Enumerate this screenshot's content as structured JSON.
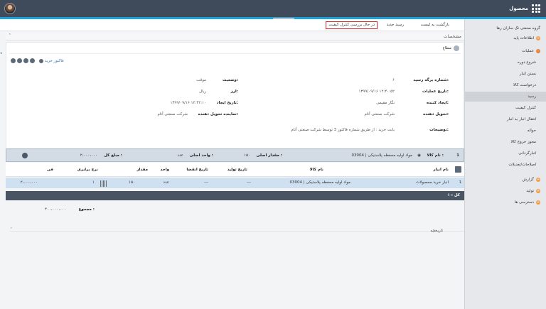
{
  "app": {
    "title": "محصول"
  },
  "toolbar": {
    "back": "بازگشت به لیست",
    "new_receipt": "رسید جدید",
    "status": "در حال بررسی کنترل کیفیت"
  },
  "section": {
    "title": "مشخصات"
  },
  "user": {
    "name": "مطاع"
  },
  "actions": {
    "invoice_link": "فاکتور خرید"
  },
  "form": {
    "receipt_no_label": "شماره برگه رسید:",
    "receipt_no": "۶",
    "status_label": "وضعیت:",
    "status": "موقت",
    "op_date_label": "تاریخ عملیات:",
    "op_date": "۱۳۹۹/۰۹/۱۶ ۱۲:۴۰:۵۲",
    "currency_label": "ارز:",
    "currency": "ریال",
    "creator_label": "ایجاد کننده:",
    "creator": "نگار مقیمی",
    "create_date_label": "تاریخ ایجاد:",
    "create_date": "۱۳۹۹/۰۹/۱۶ ۱۲:۴۲:۱۰",
    "deliverer_label": "تحویل دهنده:",
    "deliverer": "شرکت صنعتی آتام",
    "deliverer_rep_label": "نماینده تحویل دهنده:",
    "deliverer_rep": "شرکت صنعتی آتام",
    "desc_label": "توضیحات:",
    "desc": "بابت خرید : از طریق شماره فاکتور 3 توسط شرکت صنعتی آتام"
  },
  "item_strip": {
    "index": "1",
    "goods_label": "نام کالا :",
    "goods": "03004 | مواد اولیه محفظه پلاستیکی",
    "qty_label": "مقدار اصلی :",
    "qty": "۱۵۰",
    "unit_label": "واحد اصلی :",
    "unit": "عدد",
    "total_label": "مبلغ کل :",
    "total": "۲،۰۰۰،۰۰۰"
  },
  "table": {
    "headers": [
      "نام انبار",
      "نام کالا",
      "تاریخ تولید",
      "تاریخ انقضا",
      "واحد",
      "مقدار",
      "نرخ برابری",
      "فی"
    ],
    "row": {
      "index": "1",
      "warehouse": "انبار خرید محصولات",
      "goods": "03004 | مواد اولیه محفظه پلاستیکی",
      "prod_date": "---",
      "exp_date": "---",
      "unit": "عدد",
      "qty": "۱۵۰",
      "rate": "۱",
      "price": "۲،۰۰۰،۰۰۰"
    }
  },
  "total_bar": {
    "label": "کل : ۱"
  },
  "summary": {
    "label": "مجموع :",
    "value": "۳۰۰،۰۰۰،۰۰۰"
  },
  "history": {
    "label": "تاریخچه"
  },
  "sidebar": {
    "items": [
      {
        "label": "گروه صنعتی تک سازان رها"
      },
      {
        "label": "اطلاعات پایه"
      },
      {
        "label": "عملیات"
      },
      {
        "label": "شروع دوره"
      },
      {
        "label": "بستن انبار"
      },
      {
        "label": "درخواست کالا"
      },
      {
        "label": "رسید"
      },
      {
        "label": "کنترل کیفیت"
      },
      {
        "label": "انتقال انبار به انبار"
      },
      {
        "label": "حواله"
      },
      {
        "label": "مجوز خروج کالا"
      },
      {
        "label": "انبارگردانی"
      },
      {
        "label": "اصلاحات/تعدیلات"
      },
      {
        "label": "گزارش"
      },
      {
        "label": "تولید"
      },
      {
        "label": "دسترسی ها"
      }
    ]
  },
  "colors": {
    "topbar": "#3f4b5b",
    "accent": "#1aa3d8",
    "highlight_border": "#d9252a",
    "row_selected": "#cfe0f1"
  }
}
